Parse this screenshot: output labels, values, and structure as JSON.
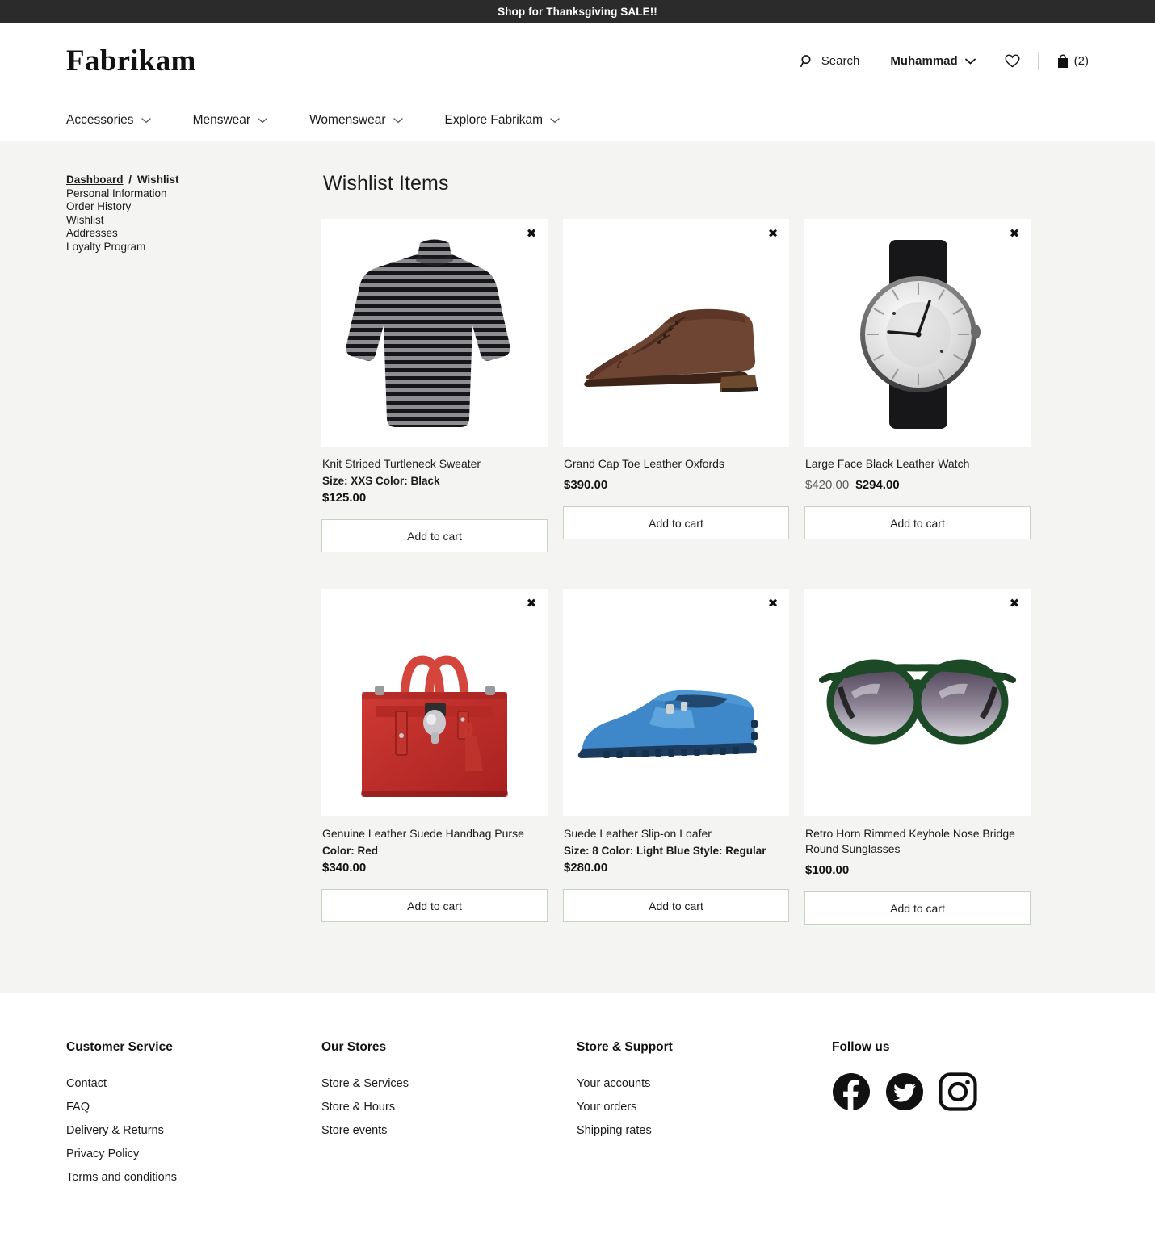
{
  "promo": {
    "text": "Shop for Thanksgiving SALE!!"
  },
  "header": {
    "brand": "Fabrikam",
    "search_label": "Search",
    "account_name": "Muhammad",
    "cart_count": "(2)",
    "icons": {
      "search": "search-icon",
      "chevron": "chevron-down-icon",
      "wishlist": "heart-icon",
      "bag": "shopping-bag-icon"
    }
  },
  "nav": {
    "items": [
      {
        "label": "Accessories"
      },
      {
        "label": "Menswear"
      },
      {
        "label": "Womenswear"
      },
      {
        "label": "Explore Fabrikam"
      }
    ]
  },
  "sidebar": {
    "breadcrumb": {
      "current_root": "Dashboard",
      "separator": "/",
      "current_page": "Wishlist"
    },
    "items": [
      {
        "label": "Personal Information"
      },
      {
        "label": "Order History"
      },
      {
        "label": "Wishlist"
      },
      {
        "label": "Addresses"
      },
      {
        "label": "Loyalty Program"
      }
    ]
  },
  "main": {
    "title": "Wishlist Items",
    "add_to_cart_label": "Add to cart",
    "remove_label": "✖",
    "products": [
      {
        "name": "Knit Striped Turtleneck Sweater",
        "attrs": "Size: XXS  Color: Black",
        "price": "$125.00",
        "old_price": "",
        "art": "sweater"
      },
      {
        "name": "Grand Cap Toe Leather Oxfords",
        "attrs": "",
        "price": "$390.00",
        "old_price": "",
        "art": "oxford"
      },
      {
        "name": "Large Face Black Leather Watch",
        "attrs": "",
        "price": "$294.00",
        "old_price": "$420.00",
        "art": "watch"
      },
      {
        "name": "Genuine Leather Suede Handbag Purse",
        "attrs": "Color: Red",
        "price": "$340.00",
        "old_price": "",
        "art": "handbag"
      },
      {
        "name": "Suede Leather Slip-on Loafer",
        "attrs": "Size: 8  Color: Light Blue  Style: Regular",
        "price": "$280.00",
        "old_price": "",
        "art": "loafer"
      },
      {
        "name": "Retro Horn Rimmed Keyhole Nose Bridge Round Sunglasses",
        "attrs": "",
        "price": "$100.00",
        "old_price": "",
        "art": "sunglasses"
      }
    ]
  },
  "footer": {
    "columns": [
      {
        "heading": "Customer Service",
        "links": [
          {
            "label": "Contact"
          },
          {
            "label": "FAQ"
          },
          {
            "label": "Delivery & Returns"
          },
          {
            "label": "Privacy Policy"
          },
          {
            "label": "Terms and conditions"
          }
        ]
      },
      {
        "heading": "Our Stores",
        "links": [
          {
            "label": "Store & Services"
          },
          {
            "label": "Store & Hours"
          },
          {
            "label": "Store events"
          }
        ]
      },
      {
        "heading": "Store & Support",
        "links": [
          {
            "label": "Your accounts"
          },
          {
            "label": "Your orders"
          },
          {
            "label": "Shipping rates"
          }
        ]
      }
    ],
    "social": {
      "heading": "Follow us",
      "icons": [
        {
          "name": "facebook-icon"
        },
        {
          "name": "twitter-icon"
        },
        {
          "name": "instagram-icon"
        }
      ]
    }
  },
  "colors": {
    "banner_bg": "#2b2b2b",
    "content_bg": "#f4f4f2",
    "button_border": "#c4d3c2",
    "text": "#1b1b1b"
  }
}
